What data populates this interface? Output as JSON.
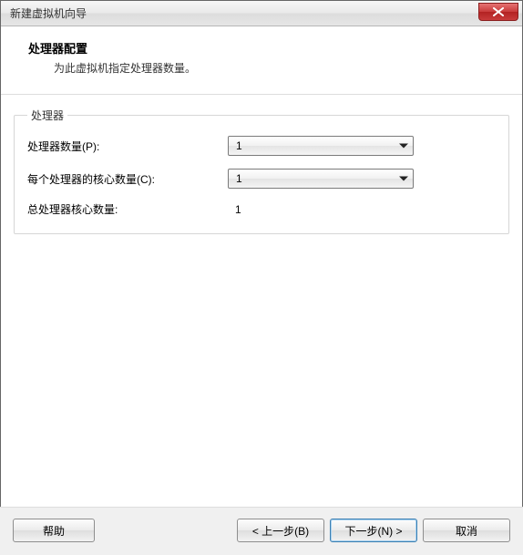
{
  "window": {
    "title": "新建虚拟机向导"
  },
  "header": {
    "title": "处理器配置",
    "subtitle": "为此虚拟机指定处理器数量。"
  },
  "group": {
    "legend": "处理器",
    "rows": {
      "proc_count": {
        "label": "处理器数量(P):",
        "value": "1"
      },
      "cores_per": {
        "label": "每个处理器的核心数量(C):",
        "value": "1"
      },
      "total": {
        "label": "总处理器核心数量:",
        "value": "1"
      }
    }
  },
  "buttons": {
    "help": "帮助",
    "back": "< 上一步(B)",
    "next": "下一步(N) >",
    "cancel": "取消"
  }
}
